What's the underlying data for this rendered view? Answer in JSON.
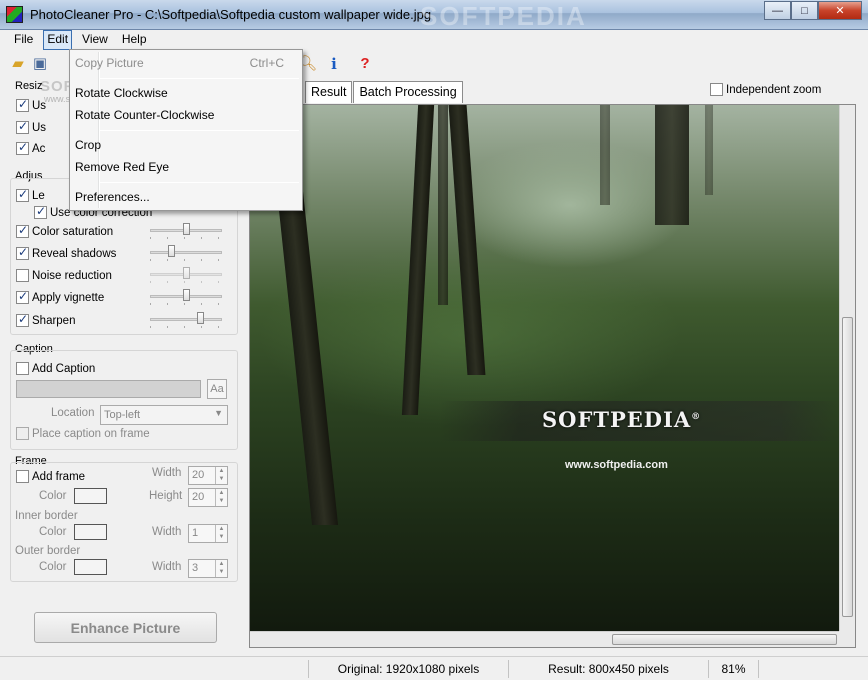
{
  "window": {
    "title": "PhotoCleaner Pro - C:\\Softpedia\\Softpedia custom wallpaper wide.jpg",
    "watermark": "SOFTPEDIA",
    "minimize": "—",
    "maximize": "□",
    "close": "✕"
  },
  "menubar": {
    "file": "File",
    "edit": "Edit",
    "view": "View",
    "help": "Help"
  },
  "toolbar": {
    "icons": [
      "open-folder-icon",
      "save-icon",
      "zoom-icon",
      "info-icon",
      "help-icon"
    ],
    "info_glyph": "i",
    "help_glyph": "?",
    "watermark": "SOFTPEDIA",
    "watermark_url": "www.softpedia.com"
  },
  "edit_menu": {
    "copy_picture": "Copy Picture",
    "copy_shortcut": "Ctrl+C",
    "rotate_cw": "Rotate Clockwise",
    "rotate_ccw": "Rotate Counter-Clockwise",
    "crop": "Crop",
    "remove_red_eye": "Remove Red Eye",
    "preferences": "Preferences..."
  },
  "left_panel": {
    "resize_group": "Resiz",
    "resize_opt1": "Us",
    "resize_opt2": "Us",
    "resize_opt3": "Ac",
    "adjust_group": "Adjus",
    "levels": "Le",
    "use_color_correction": "Use color correction",
    "color_saturation": "Color saturation",
    "reveal_shadows": "Reveal shadows",
    "noise_reduction": "Noise reduction",
    "apply_vignette": "Apply vignette",
    "sharpen": "Sharpen",
    "caption_group": "Caption",
    "add_caption": "Add Caption",
    "font_button": "Aa",
    "location_label": "Location",
    "location_value": "Top-left",
    "place_caption": "Place caption on frame",
    "frame_group": "Frame",
    "add_frame": "Add frame",
    "color_label": "Color",
    "width_label": "Width",
    "height_label": "Height",
    "frame_width": "20",
    "frame_height": "20",
    "inner_border": "Inner border",
    "inner_width": "1",
    "outer_border": "Outer border",
    "outer_width": "3",
    "enhance_button": "Enhance Picture"
  },
  "sliders": {
    "color_saturation": 0.5,
    "reveal_shadows": 0.28,
    "noise_reduction": 0.5,
    "apply_vignette": 0.5,
    "sharpen": 0.72
  },
  "tabs": {
    "result": "Result",
    "batch": "Batch Processing"
  },
  "independent_zoom": "Independent zoom",
  "image": {
    "logo": "SOFTPEDIA",
    "logo_mark": "®",
    "url": "www.softpedia.com"
  },
  "status": {
    "original": "Original: 1920x1080 pixels",
    "result": "Result: 800x450 pixels",
    "zoom": "81%"
  },
  "colors": {
    "accent": "#3a6fb0",
    "title_gradient": "#a9c1de"
  }
}
